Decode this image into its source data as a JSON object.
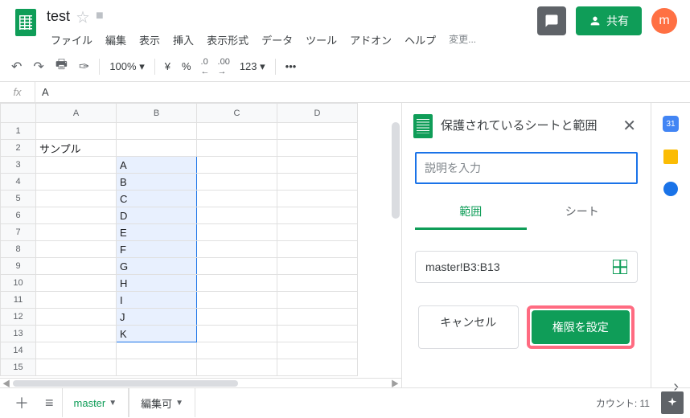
{
  "header": {
    "doc_title": "test",
    "avatar_letter": "m",
    "share_label": "共有",
    "last_edit": "変更..."
  },
  "menubar": [
    "ファイル",
    "編集",
    "表示",
    "挿入",
    "表示形式",
    "データ",
    "ツール",
    "アドオン",
    "ヘルプ"
  ],
  "toolbar": {
    "zoom": "100%",
    "currency": "¥",
    "percent": "%",
    "dec_dec": ".0",
    "inc_dec": ".00",
    "num_format": "123",
    "more": "•••"
  },
  "formula_bar": {
    "fx": "fx",
    "value": "A"
  },
  "columns": [
    "A",
    "B",
    "C",
    "D"
  ],
  "rows": [
    {
      "n": 1,
      "A": "",
      "B": ""
    },
    {
      "n": 2,
      "A": "サンプル",
      "B": ""
    },
    {
      "n": 3,
      "A": "",
      "B": "A"
    },
    {
      "n": 4,
      "A": "",
      "B": "B"
    },
    {
      "n": 5,
      "A": "",
      "B": "C"
    },
    {
      "n": 6,
      "A": "",
      "B": "D"
    },
    {
      "n": 7,
      "A": "",
      "B": "E"
    },
    {
      "n": 8,
      "A": "",
      "B": "F"
    },
    {
      "n": 9,
      "A": "",
      "B": "G"
    },
    {
      "n": 10,
      "A": "",
      "B": "H"
    },
    {
      "n": 11,
      "A": "",
      "B": "I"
    },
    {
      "n": 12,
      "A": "",
      "B": "J"
    },
    {
      "n": 13,
      "A": "",
      "B": "K"
    },
    {
      "n": 14,
      "A": "",
      "B": ""
    },
    {
      "n": 15,
      "A": "",
      "B": ""
    }
  ],
  "panel": {
    "title": "保護されているシートと範囲",
    "desc_placeholder": "説明を入力",
    "tab_range": "範囲",
    "tab_sheet": "シート",
    "range_value": "master!B3:B13",
    "cancel": "キャンセル",
    "set_perm": "権限を設定"
  },
  "rail": {
    "calendar_label": "31"
  },
  "bottom": {
    "sheet1": "master",
    "sheet2": "編集可",
    "count_label": "カウント: 11"
  }
}
